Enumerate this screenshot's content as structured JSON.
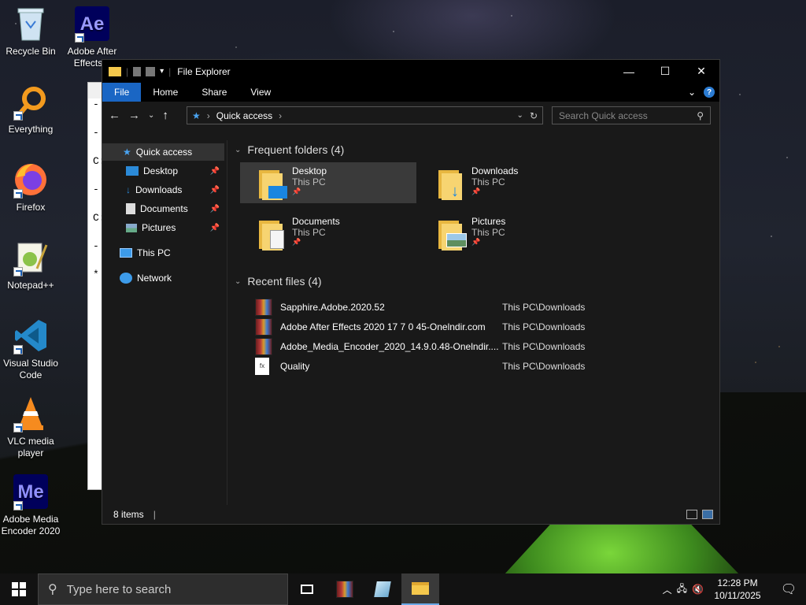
{
  "desktop": {
    "icons": [
      {
        "label": "Recycle Bin"
      },
      {
        "label": "Adobe After Effects 2"
      },
      {
        "label": "Everything"
      },
      {
        "label": "Firefox"
      },
      {
        "label": "Notepad++"
      },
      {
        "label": "Visual Studio Code"
      },
      {
        "label": "VLC media player"
      },
      {
        "label": "Adobe Media Encoder 2020"
      }
    ],
    "ae_glyph": "Ae",
    "me_glyph": "Me"
  },
  "bg_window": {
    "lines": [
      "-",
      "-",
      "C:",
      "-",
      "C:",
      "-",
      "*"
    ]
  },
  "explorer": {
    "title": "File Explorer",
    "window_buttons": {
      "minimize": "—",
      "maximize": "☐",
      "close": "✕"
    },
    "ribbon": {
      "file": "File",
      "home": "Home",
      "share": "Share",
      "view": "View"
    },
    "address": {
      "location": "Quick access"
    },
    "search": {
      "placeholder": "Search Quick access"
    },
    "nav": {
      "quick_access": "Quick access",
      "desktop": "Desktop",
      "downloads": "Downloads",
      "documents": "Documents",
      "pictures": "Pictures",
      "this_pc": "This PC",
      "network": "Network"
    },
    "frequent": {
      "heading": "Frequent folders (4)",
      "folders": [
        {
          "name": "Desktop",
          "loc": "This PC"
        },
        {
          "name": "Downloads",
          "loc": "This PC"
        },
        {
          "name": "Documents",
          "loc": "This PC"
        },
        {
          "name": "Pictures",
          "loc": "This PC"
        }
      ]
    },
    "recent": {
      "heading": "Recent files (4)",
      "files": [
        {
          "name": "Sapphire.Adobe.2020.52",
          "loc": "This PC\\Downloads"
        },
        {
          "name": "Adobe After Effects 2020 17 7 0 45-Onelndir.com",
          "loc": "This PC\\Downloads"
        },
        {
          "name": "Adobe_Media_Encoder_2020_14.9.0.48-Onelndir....",
          "loc": "This PC\\Downloads"
        },
        {
          "name": "Quality",
          "loc": "This PC\\Downloads"
        }
      ]
    },
    "status": {
      "items": "8 items"
    }
  },
  "taskbar": {
    "search_placeholder": "Type here to search",
    "time": "12:28 PM",
    "date": "10/11/2025"
  }
}
